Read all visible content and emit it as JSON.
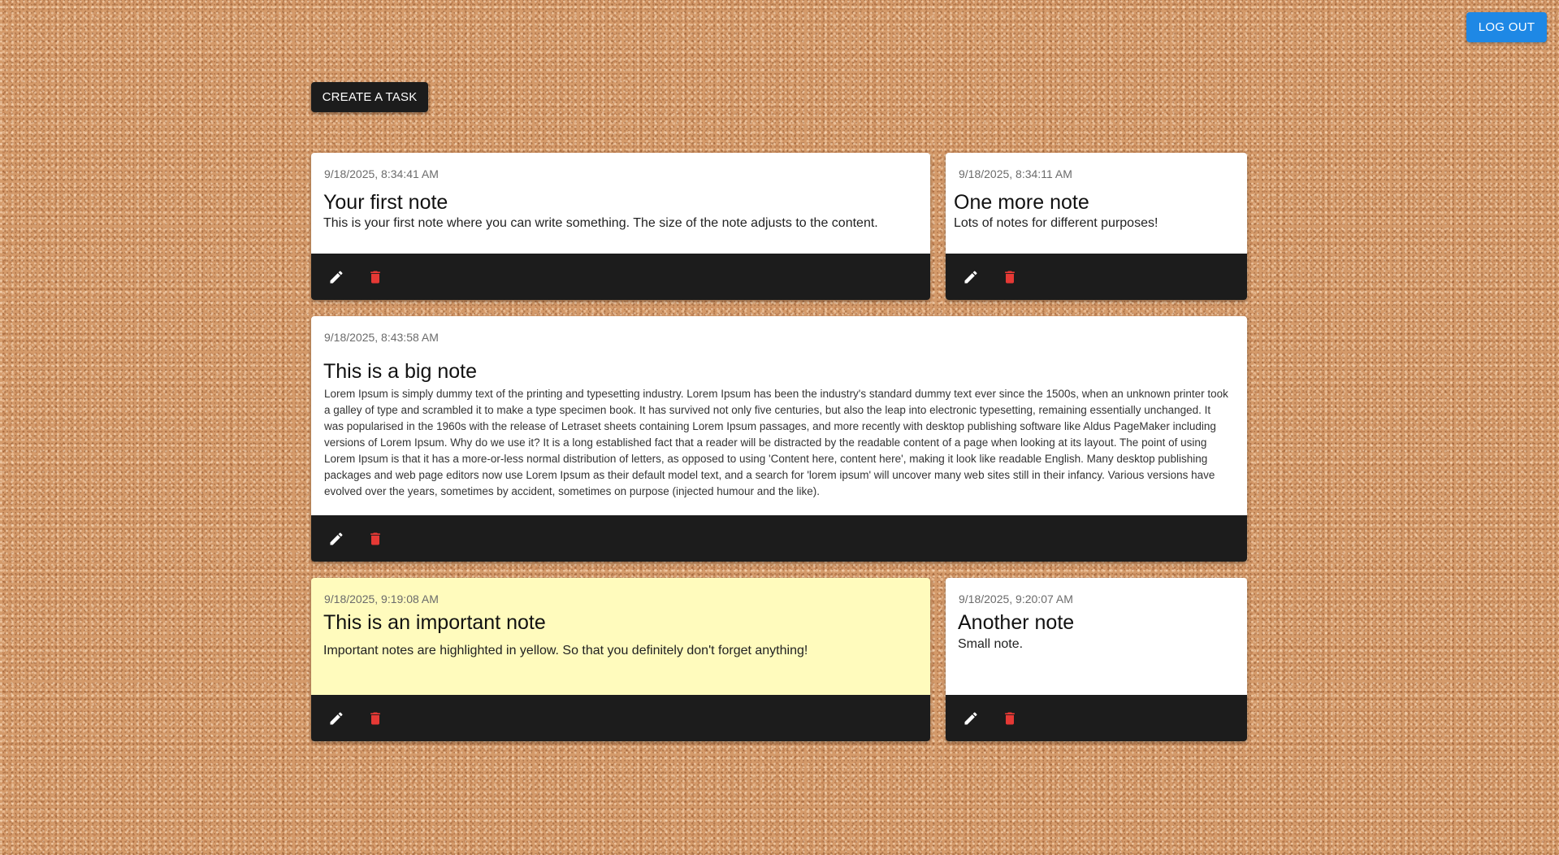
{
  "header": {
    "logout_label": "LOG OUT",
    "logout_color": "#1e88e5"
  },
  "toolbar": {
    "create_label": "CREATE A TASK"
  },
  "icons": {
    "edit": "pencil-icon",
    "delete": "trash-icon",
    "delete_color": "#e53935"
  },
  "notes": [
    {
      "date": "9/18/2025, 8:34:41 AM",
      "title": "Your first note",
      "text": "This is your first note where you can write something. The size of the note adjusts to the content.",
      "important": false
    },
    {
      "date": "9/18/2025, 8:34:11 AM",
      "title": "One more note",
      "text": "Lots of notes for different purposes!",
      "important": false
    },
    {
      "date": "9/18/2025, 8:43:58 AM",
      "title": "This is a big note",
      "text": "Lorem Ipsum is simply dummy text of the printing and typesetting industry. Lorem Ipsum has been the industry's standard dummy text ever since the 1500s, when an unknown printer took a galley of type and scrambled it to make a type specimen book. It has survived not only five centuries, but also the leap into electronic typesetting, remaining essentially unchanged. It was popularised in the 1960s with the release of Letraset sheets containing Lorem Ipsum passages, and more recently with desktop publishing software like Aldus PageMaker including versions of Lorem Ipsum. Why do we use it? It is a long established fact that a reader will be distracted by the readable content of a page when looking at its layout. The point of using Lorem Ipsum is that it has a more-or-less normal distribution of letters, as opposed to using 'Content here, content here', making it look like readable English. Many desktop publishing packages and web page editors now use Lorem Ipsum as their default model text, and a search for 'lorem ipsum' will uncover many web sites still in their infancy. Various versions have evolved over the years, sometimes by accident, sometimes on purpose (injected humour and the like).",
      "important": false
    },
    {
      "date": "9/18/2025, 9:19:08 AM",
      "title": "This is an important note",
      "text": "Important notes are highlighted in yellow. So that you definitely don't forget anything!",
      "important": true,
      "highlight_color": "#fffbbd"
    },
    {
      "date": "9/18/2025, 9:20:07 AM",
      "title": "Another note",
      "text": "Small note.",
      "important": false
    }
  ]
}
